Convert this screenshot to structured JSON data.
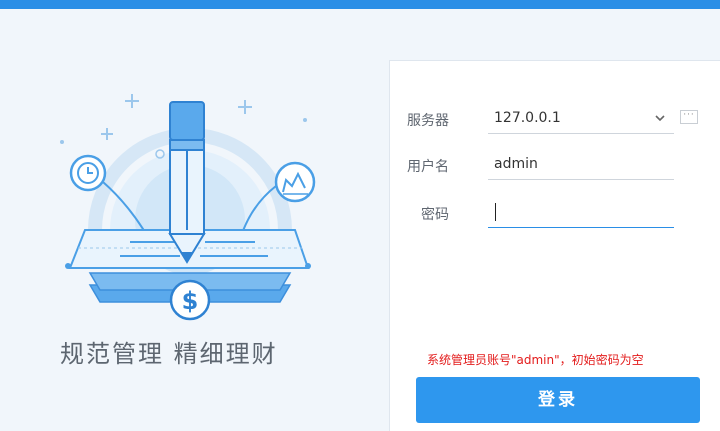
{
  "colors": {
    "accent": "#2a8ee6",
    "button": "#2e97ee",
    "hint_text": "#e31b1b",
    "illustration_line": "#4a9fe6"
  },
  "left": {
    "slogan": "规范管理  精细理财",
    "illustration_icons": [
      "pencil-icon",
      "clock-icon",
      "chart-icon",
      "dollar-icon",
      "document-stack-icon"
    ]
  },
  "form": {
    "server": {
      "label": "服务器",
      "value": "127.0.0.1",
      "icon": "chevron-down-icon",
      "more_icon": "ellipsis-icon"
    },
    "username": {
      "label": "用户名",
      "value": "admin"
    },
    "password": {
      "label": "密码",
      "value": ""
    },
    "hint": "系统管理员账号\"admin\"，初始密码为空",
    "login_button": "登录"
  }
}
